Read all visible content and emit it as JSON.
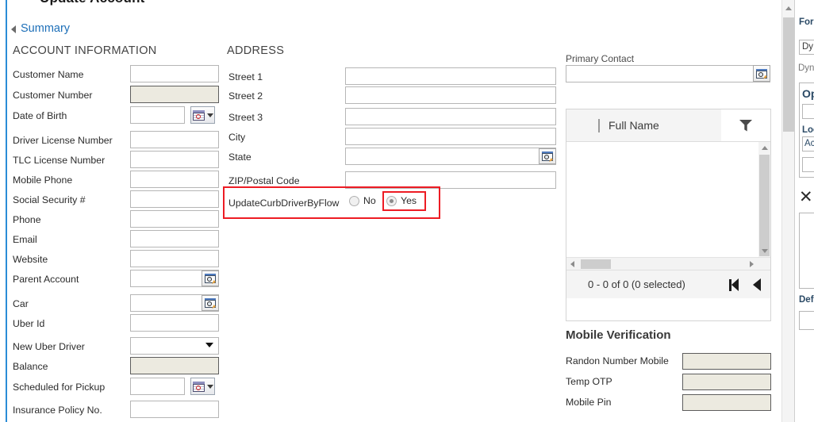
{
  "page": {
    "title": "Update Account",
    "summary_label": "Summary"
  },
  "sections": {
    "account_information": "ACCOUNT INFORMATION",
    "address": "ADDRESS",
    "mobile_verification": "Mobile Verification"
  },
  "account_fields": [
    {
      "label": "Customer Name",
      "value": "",
      "type": "text",
      "readonly": false
    },
    {
      "label": "Customer Number",
      "value": "",
      "type": "text",
      "readonly": true
    },
    {
      "label": "Date of Birth",
      "value": "",
      "type": "date",
      "readonly": false
    },
    {
      "label": "Driver License Number",
      "value": "",
      "type": "text",
      "readonly": false
    },
    {
      "label": "TLC License Number",
      "value": "",
      "type": "text",
      "readonly": false
    },
    {
      "label": "Mobile Phone",
      "value": "",
      "type": "text",
      "readonly": false
    },
    {
      "label": "Social Security #",
      "value": "",
      "type": "text",
      "readonly": false
    },
    {
      "label": "Phone",
      "value": "",
      "type": "text",
      "readonly": false
    },
    {
      "label": "Email",
      "value": "",
      "type": "text",
      "readonly": false
    },
    {
      "label": "Website",
      "value": "",
      "type": "text",
      "readonly": false
    },
    {
      "label": "Parent Account",
      "value": "",
      "type": "lookup",
      "readonly": false
    },
    {
      "label": "Car",
      "value": "",
      "type": "lookup",
      "readonly": false
    },
    {
      "label": "Uber Id",
      "value": "",
      "type": "text",
      "readonly": false
    },
    {
      "label": "New Uber Driver",
      "value": "",
      "type": "select",
      "readonly": false
    },
    {
      "label": "Balance",
      "value": "",
      "type": "text",
      "readonly": true
    },
    {
      "label": "Scheduled for Pickup",
      "value": "",
      "type": "date",
      "readonly": false
    },
    {
      "label": "Insurance Policy No.",
      "value": "",
      "type": "text",
      "readonly": false
    }
  ],
  "address_fields": [
    {
      "label": "Street 1",
      "value": "",
      "type": "text"
    },
    {
      "label": "Street 2",
      "value": "",
      "type": "text"
    },
    {
      "label": "Street 3",
      "value": "",
      "type": "text"
    },
    {
      "label": "City",
      "value": "",
      "type": "text"
    },
    {
      "label": "State",
      "value": "",
      "type": "lookup"
    },
    {
      "label": "ZIP/Postal Code",
      "value": "",
      "type": "text"
    }
  ],
  "toggle": {
    "label": "UpdateCurbDriverByFlow",
    "option_no": "No",
    "option_yes": "Yes",
    "selected": "Yes",
    "highlight_color": "#ed1c24"
  },
  "primary_contact": {
    "label": "Primary Contact",
    "value": "",
    "lookup_icon": "lookup-magnifier-icon"
  },
  "contacts_grid": {
    "column_header": "Full Name",
    "filter_icon": "funnel-filter-icon",
    "record_count": "0 - 0 of 0 (0 selected)",
    "rows": [],
    "pager_first_icon": "page-first-icon",
    "pager_prev_icon": "page-previous-icon"
  },
  "mobile_verification_fields": [
    {
      "label": "Randon Number Mobile",
      "value": "",
      "readonly": true
    },
    {
      "label": "Temp OTP",
      "value": "",
      "readonly": true
    },
    {
      "label": "Mobile Pin",
      "value": "",
      "readonly": true
    }
  ],
  "side_panel": {
    "form_label": "For",
    "form_value": "Dy",
    "form_hint": "Dyna",
    "options_label": "Op",
    "location_label": "Loc",
    "location_value": "Ac",
    "close_icon": "close-x-icon",
    "default_label": "Def"
  }
}
